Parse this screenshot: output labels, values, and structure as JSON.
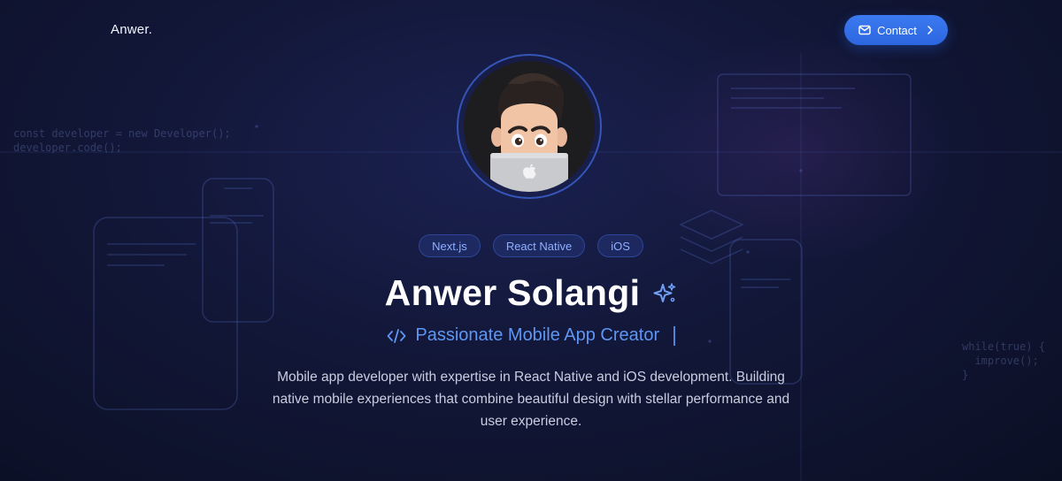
{
  "header": {
    "logo": "Anwer.",
    "contact_label": "Contact"
  },
  "background_code": {
    "left": "const developer = new Developer();\ndeveloper.code();",
    "right": "while(true) {\n  improve();\n}"
  },
  "hero": {
    "avatar_alt": "Anwer Solangi memoji avatar",
    "tags": [
      "Next.js",
      "React Native",
      "iOS"
    ],
    "name": "Anwer Solangi",
    "role": "Passionate Mobile App Creator",
    "description": "Mobile app developer with expertise in React Native and iOS development. Building native mobile experiences that combine beautiful design with stellar performance and user experience."
  },
  "colors": {
    "accent": "#3b7af0",
    "role_text": "#5e96f2",
    "tag_text": "#8fb0ff",
    "background": "#121738"
  },
  "icons": {
    "contact": "mail-icon",
    "contact_arrow": "chevron-right-icon",
    "name_badge": "sparkles-icon",
    "role_prefix": "code-icon"
  }
}
